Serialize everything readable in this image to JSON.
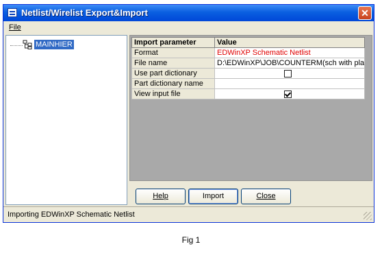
{
  "window": {
    "title": "Netlist/Wirelist Export&Import",
    "close_label": "✕"
  },
  "menu": {
    "file_label": "File"
  },
  "tree": {
    "items": [
      {
        "label": "MAINHIER"
      }
    ]
  },
  "grid": {
    "headers": {
      "param": "Import parameter",
      "value": "Value"
    },
    "rows": [
      {
        "param": "Format",
        "value": "EDWinXP Schematic Netlist",
        "kind": "text"
      },
      {
        "param": "File name",
        "value": "D:\\EDWinXP\\JOB\\COUNTERM(sch with pla",
        "kind": "text"
      },
      {
        "param": "Use part dictionary",
        "value": "",
        "kind": "checkbox",
        "checked": false
      },
      {
        "param": "Part dictionary name",
        "value": "",
        "kind": "text"
      },
      {
        "param": "View input file",
        "value": "",
        "kind": "checkbox",
        "checked": true
      }
    ]
  },
  "buttons": {
    "help": "Help",
    "import": "Import",
    "close": "Close"
  },
  "status": {
    "text": "Importing EDWinXP Schematic Netlist"
  },
  "caption": "Fig 1",
  "colors": {
    "title_bar": "#0a5fe0",
    "selection": "#316ac5",
    "format_value": "#e00000"
  },
  "icons": {
    "app": "window-swap-icon",
    "tree_node": "hierarchy-icon",
    "close": "close-icon"
  }
}
